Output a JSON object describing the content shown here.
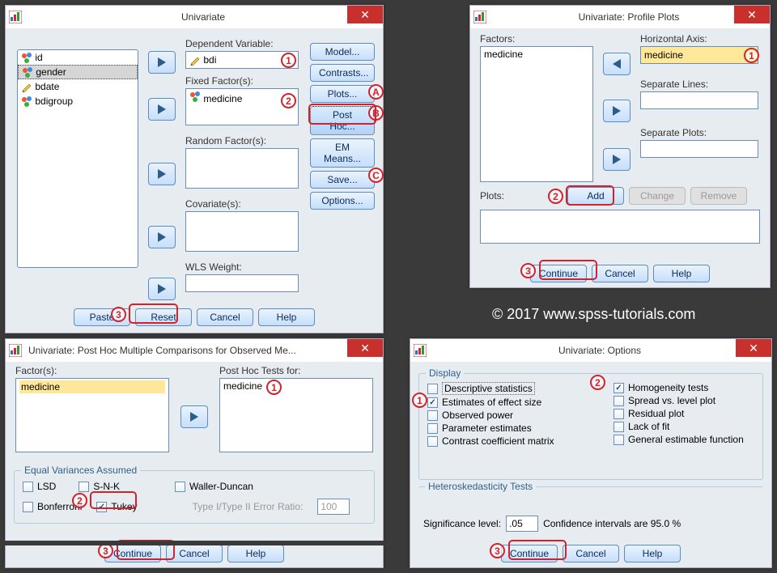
{
  "footer_credit": "© 2017 www.spss-tutorials.com",
  "univariate": {
    "title": "Univariate",
    "vars": {
      "id": "id",
      "gender": "gender",
      "bdate": "bdate",
      "bdigroup": "bdigroup"
    },
    "lbl_dependent": "Dependent Variable:",
    "dependent": "bdi",
    "lbl_fixed": "Fixed Factor(s):",
    "fixed": "medicine",
    "lbl_random": "Random Factor(s):",
    "lbl_cov": "Covariate(s):",
    "lbl_wls": "WLS Weight:",
    "btn_model": "Model...",
    "btn_contrasts": "Contrasts...",
    "btn_plots": "Plots...",
    "btn_posthoc": "Post Hoc...",
    "btn_emmeans": "EM Means...",
    "btn_save": "Save...",
    "btn_options": "Options...",
    "btn_paste": "Paste",
    "btn_reset": "Reset",
    "btn_cancel": "Cancel",
    "btn_help": "Help"
  },
  "posthoc": {
    "title": "Univariate: Post Hoc Multiple Comparisons for Observed Me...",
    "lbl_factors": "Factor(s):",
    "factor": "medicine",
    "lbl_tests": "Post Hoc Tests for:",
    "tests": "medicine",
    "grp_equal": "Equal Variances Assumed",
    "lsd": "LSD",
    "snk": "S-N-K",
    "waller": "Waller-Duncan",
    "bonferroni": "Bonferroni",
    "tukey": "Tukey",
    "ratio_lbl": "Type I/Type II Error Ratio:",
    "ratio_val": "100",
    "btn_continue": "Continue",
    "btn_cancel": "Cancel",
    "btn_help": "Help"
  },
  "profile": {
    "title": "Univariate: Profile Plots",
    "lbl_factors": "Factors:",
    "factor": "medicine",
    "lbl_haxis": "Horizontal Axis:",
    "haxis": "medicine",
    "lbl_seplines": "Separate Lines:",
    "lbl_sepplots": "Separate Plots:",
    "lbl_plots": "Plots:",
    "btn_add": "Add",
    "btn_change": "Change",
    "btn_remove": "Remove",
    "btn_continue": "Continue",
    "btn_cancel": "Cancel",
    "btn_help": "Help"
  },
  "options": {
    "title": "Univariate: Options",
    "grp_display": "Display",
    "desc": "Descriptive statistics",
    "homog": "Homogeneity tests",
    "est": "Estimates of effect size",
    "spread": "Spread vs. level plot",
    "obs": "Observed power",
    "resid": "Residual plot",
    "param": "Parameter estimates",
    "lack": "Lack of fit",
    "contrast": "Contrast coefficient matrix",
    "gen": "General estimable function",
    "grp_het": "Heteroskedasticity Tests",
    "siglbl": "Significance level:",
    "sigval": ".05",
    "conflbl": "Confidence intervals are 95.0 %",
    "btn_continue": "Continue",
    "btn_cancel": "Cancel",
    "btn_help": "Help"
  }
}
